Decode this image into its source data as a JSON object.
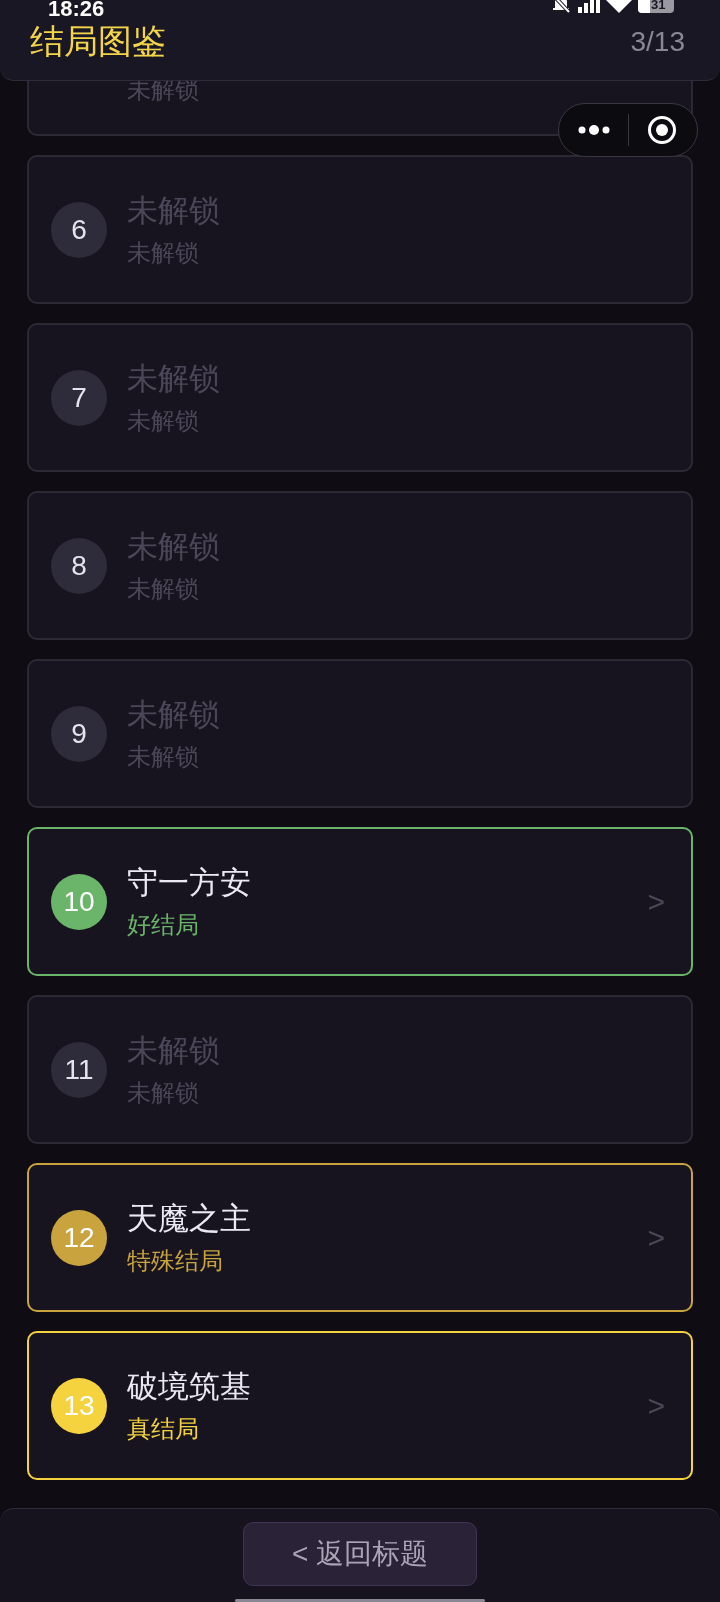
{
  "status_bar": {
    "time": "18:26",
    "battery": "31"
  },
  "header": {
    "title": "结局图鉴",
    "progress": "3/13"
  },
  "endings": [
    {
      "kind": "locked",
      "subtitle": "未解锁"
    },
    {
      "kind": "locked",
      "number": "6",
      "title": "未解锁",
      "subtitle": "未解锁"
    },
    {
      "kind": "locked",
      "number": "7",
      "title": "未解锁",
      "subtitle": "未解锁"
    },
    {
      "kind": "locked",
      "number": "8",
      "title": "未解锁",
      "subtitle": "未解锁"
    },
    {
      "kind": "locked",
      "number": "9",
      "title": "未解锁",
      "subtitle": "未解锁"
    },
    {
      "kind": "unlocked",
      "number": "10",
      "title": "守一方安",
      "subtitle": "好结局",
      "color": "#6ab56a",
      "chevron": ">"
    },
    {
      "kind": "locked",
      "number": "11",
      "title": "未解锁",
      "subtitle": "未解锁"
    },
    {
      "kind": "unlocked",
      "number": "12",
      "title": "天魔之主",
      "subtitle": "特殊结局",
      "color": "#c9a43e",
      "chevron": ">"
    },
    {
      "kind": "unlocked",
      "number": "13",
      "title": "破境筑基",
      "subtitle": "真结局",
      "color": "#f5d33f",
      "chevron": ">"
    }
  ],
  "back_button": {
    "label": "< 返回标题"
  }
}
